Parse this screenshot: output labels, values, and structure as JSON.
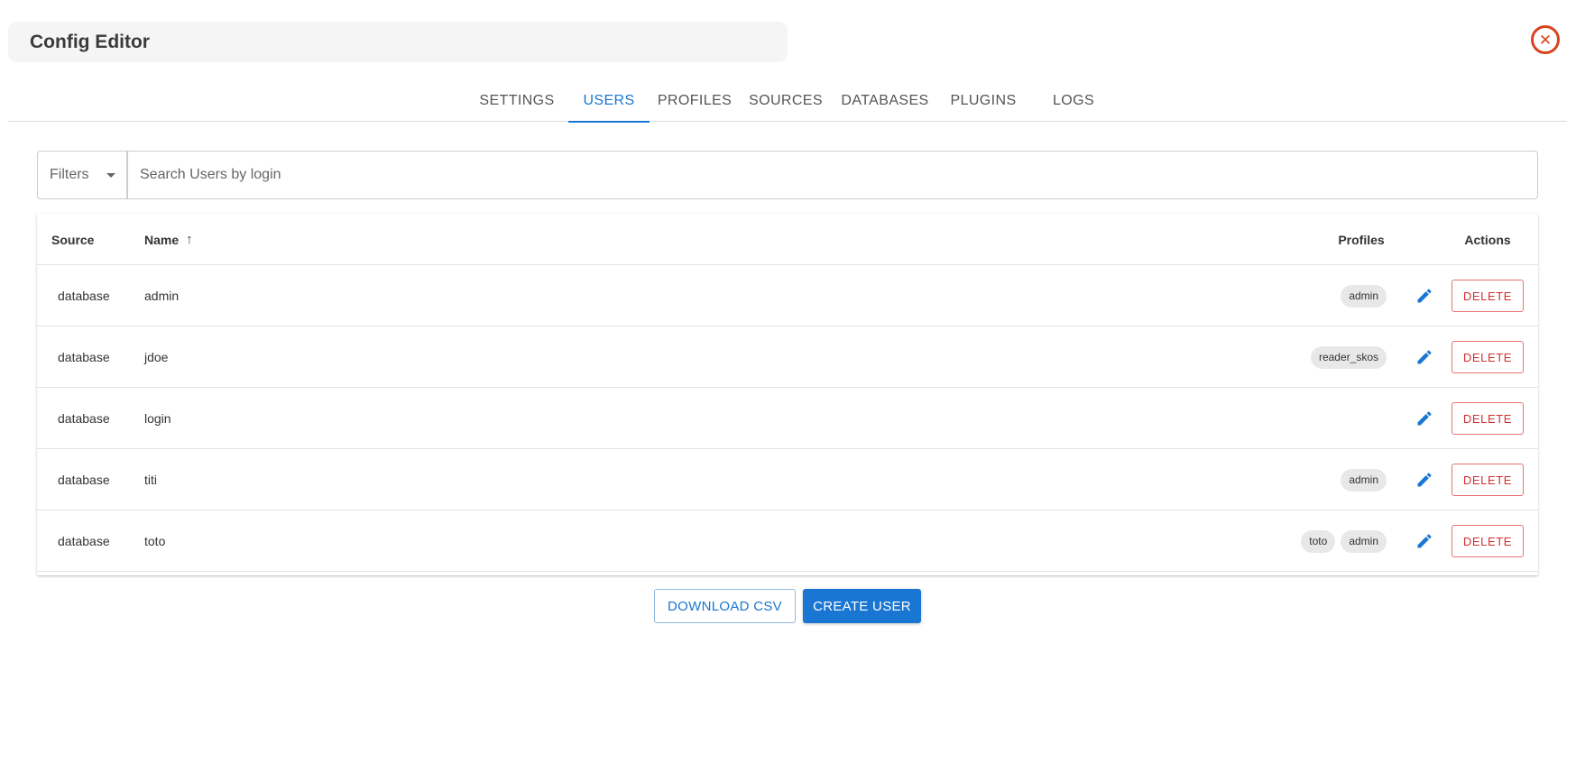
{
  "header": {
    "title": "Config Editor",
    "close_icon": "close-circle-icon"
  },
  "tabs": [
    {
      "label": "SETTINGS",
      "active": false
    },
    {
      "label": "USERS",
      "active": true
    },
    {
      "label": "PROFILES",
      "active": false
    },
    {
      "label": "SOURCES",
      "active": false
    },
    {
      "label": "DATABASES",
      "active": false
    },
    {
      "label": "PLUGINS",
      "active": false
    },
    {
      "label": "LOGS",
      "active": false
    }
  ],
  "search": {
    "filter_label": "Filters",
    "placeholder": "Search Users by login",
    "value": ""
  },
  "table": {
    "columns": {
      "source": "Source",
      "name": "Name",
      "profiles": "Profiles",
      "actions": "Actions"
    },
    "sort": {
      "column": "Name",
      "direction": "ascending",
      "icon": "arrow-up-icon"
    },
    "rows": [
      {
        "source": "database",
        "name": "admin",
        "profiles": [
          "admin"
        ],
        "delete_label": "DELETE"
      },
      {
        "source": "database",
        "name": "jdoe",
        "profiles": [
          "reader_skos"
        ],
        "delete_label": "DELETE"
      },
      {
        "source": "database",
        "name": "login",
        "profiles": [],
        "delete_label": "DELETE"
      },
      {
        "source": "database",
        "name": "titi",
        "profiles": [
          "admin"
        ],
        "delete_label": "DELETE"
      },
      {
        "source": "database",
        "name": "toto",
        "profiles": [
          "toto",
          "admin"
        ],
        "delete_label": "DELETE"
      }
    ]
  },
  "footer": {
    "download_label": "DOWNLOAD CSV",
    "create_label": "CREATE USER"
  },
  "colors": {
    "accent": "#1976d2",
    "danger": "#d32f2f",
    "close": "#d9431f",
    "chip_bg": "#e8e8e8"
  }
}
